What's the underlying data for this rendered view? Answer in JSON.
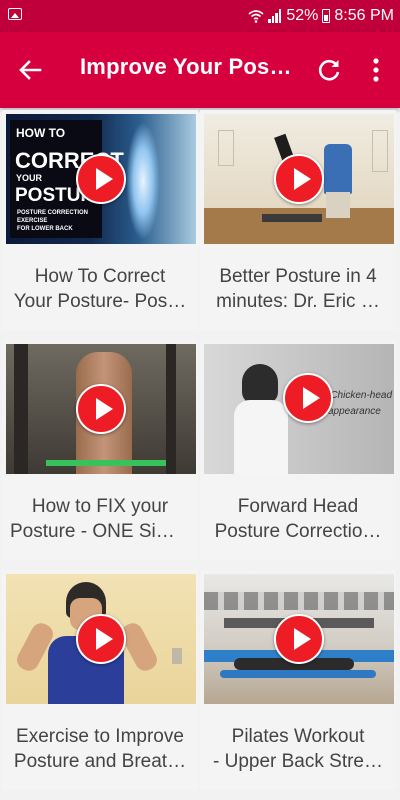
{
  "status": {
    "battery": "52%",
    "time": "8:56 PM"
  },
  "appbar": {
    "title": "Improve Your Posture"
  },
  "thumb1": {
    "line1": "HOW TO",
    "line2": "CORRECT",
    "line3": "YOUR",
    "line4": "POSTURE",
    "line5": "POSTURE CORRECTION",
    "line6": "EXERCISE",
    "line7": "FOR LOWER BACK"
  },
  "thumb4": {
    "line1": "...Chicken-head",
    "line2": "appearance"
  },
  "videos": [
    {
      "line1": "How To Correct",
      "line2": "Your Posture- Pos…"
    },
    {
      "line1": "Better Posture in 4",
      "line2": "minutes:  Dr. Eric …"
    },
    {
      "line1": "How to FIX your",
      "line2": "Posture - ONE Sim…"
    },
    {
      "line1": "Forward Head",
      "line2": "Posture Correctio…"
    },
    {
      "line1": "Exercise to Improve",
      "line2": "Posture and Breat…"
    },
    {
      "line1": "Pilates Workout",
      "line2": "- Upper Back Stre…"
    }
  ],
  "colors": {
    "statusbar": "#c0003a",
    "appbar": "#d6003f",
    "play": "#ee1c24"
  },
  "icons": {
    "back": "arrow-back-icon",
    "refresh": "refresh-icon",
    "more": "more-vert-icon",
    "play": "play-icon"
  }
}
